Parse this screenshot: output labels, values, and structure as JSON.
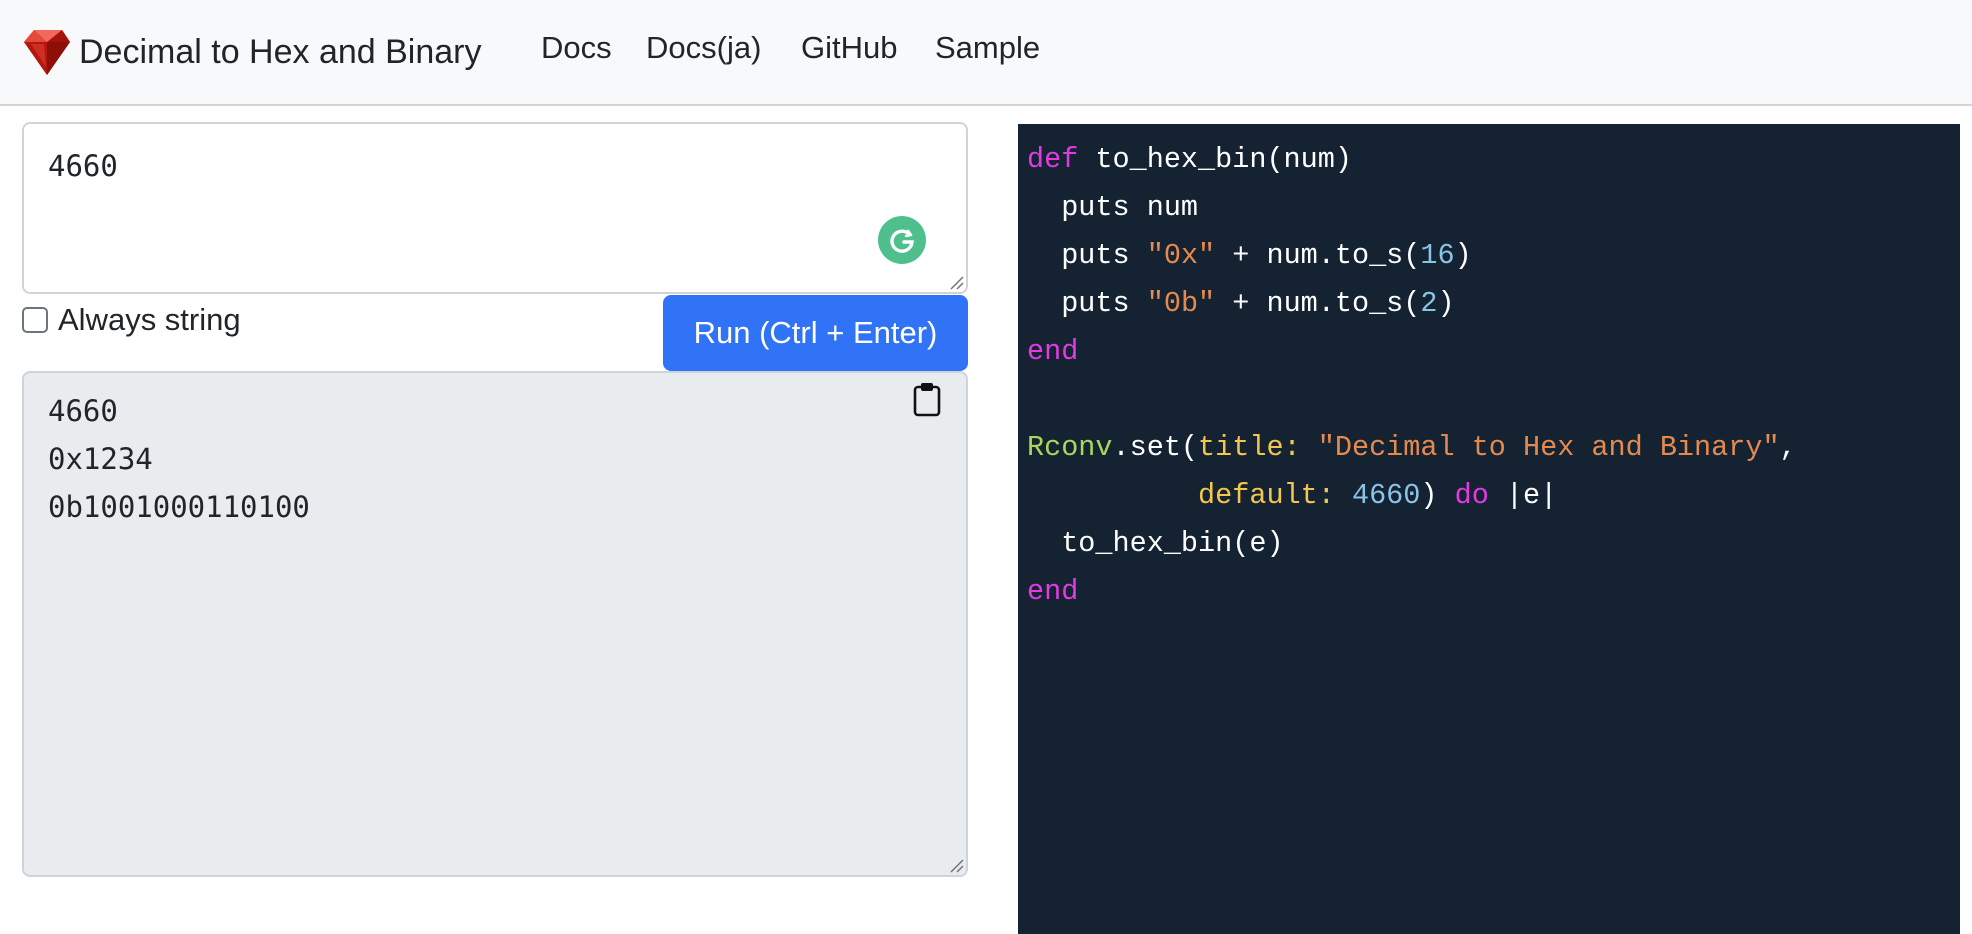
{
  "navbar": {
    "brand": "Decimal to Hex and Binary",
    "links": [
      "Docs",
      "Docs(ja)",
      "GitHub",
      "Sample"
    ]
  },
  "input": {
    "value": "4660",
    "always_string_label": "Always string",
    "always_string_checked": false
  },
  "run_button": {
    "label": "Run (Ctrl + Enter)"
  },
  "output": {
    "lines": [
      "4660",
      "0x1234",
      "0b1001000110100"
    ]
  },
  "code": {
    "lines": [
      [
        {
          "t": "def",
          "c": "kw"
        },
        {
          "t": " to_hex_bin(num)",
          "c": "plain"
        }
      ],
      [
        {
          "t": "  puts num",
          "c": "plain"
        }
      ],
      [
        {
          "t": "  puts ",
          "c": "plain"
        },
        {
          "t": "\"0x\"",
          "c": "str"
        },
        {
          "t": " + num.to_s(",
          "c": "plain"
        },
        {
          "t": "16",
          "c": "num"
        },
        {
          "t": ")",
          "c": "plain"
        }
      ],
      [
        {
          "t": "  puts ",
          "c": "plain"
        },
        {
          "t": "\"0b\"",
          "c": "str"
        },
        {
          "t": " + num.to_s(",
          "c": "plain"
        },
        {
          "t": "2",
          "c": "num"
        },
        {
          "t": ")",
          "c": "plain"
        }
      ],
      [
        {
          "t": "end",
          "c": "kw"
        }
      ],
      [],
      [
        {
          "t": "Rconv",
          "c": "const"
        },
        {
          "t": ".set(",
          "c": "plain"
        },
        {
          "t": "title:",
          "c": "sym"
        },
        {
          "t": " ",
          "c": "plain"
        },
        {
          "t": "\"Decimal to Hex and Binary\"",
          "c": "str"
        },
        {
          "t": ",",
          "c": "plain"
        }
      ],
      [
        {
          "t": "          ",
          "c": "plain"
        },
        {
          "t": "default:",
          "c": "sym"
        },
        {
          "t": " ",
          "c": "plain"
        },
        {
          "t": "4660",
          "c": "num"
        },
        {
          "t": ") ",
          "c": "plain"
        },
        {
          "t": "do",
          "c": "kw"
        },
        {
          "t": " |e|",
          "c": "plain"
        }
      ],
      [
        {
          "t": "  to_hex_bin(e)",
          "c": "plain"
        }
      ],
      [
        {
          "t": "end",
          "c": "kw"
        }
      ]
    ]
  },
  "colors": {
    "primary": "#3173f6",
    "editor_bg": "#152232",
    "keyword": "#e13ae3",
    "string": "#e58a4f",
    "number": "#8ac3e6",
    "constant": "#a8d85a",
    "symbol": "#f3c64e"
  },
  "icons": {
    "brand": "ruby-gem-icon",
    "grammarly": "grammarly-icon",
    "copy": "clipboard-icon"
  }
}
